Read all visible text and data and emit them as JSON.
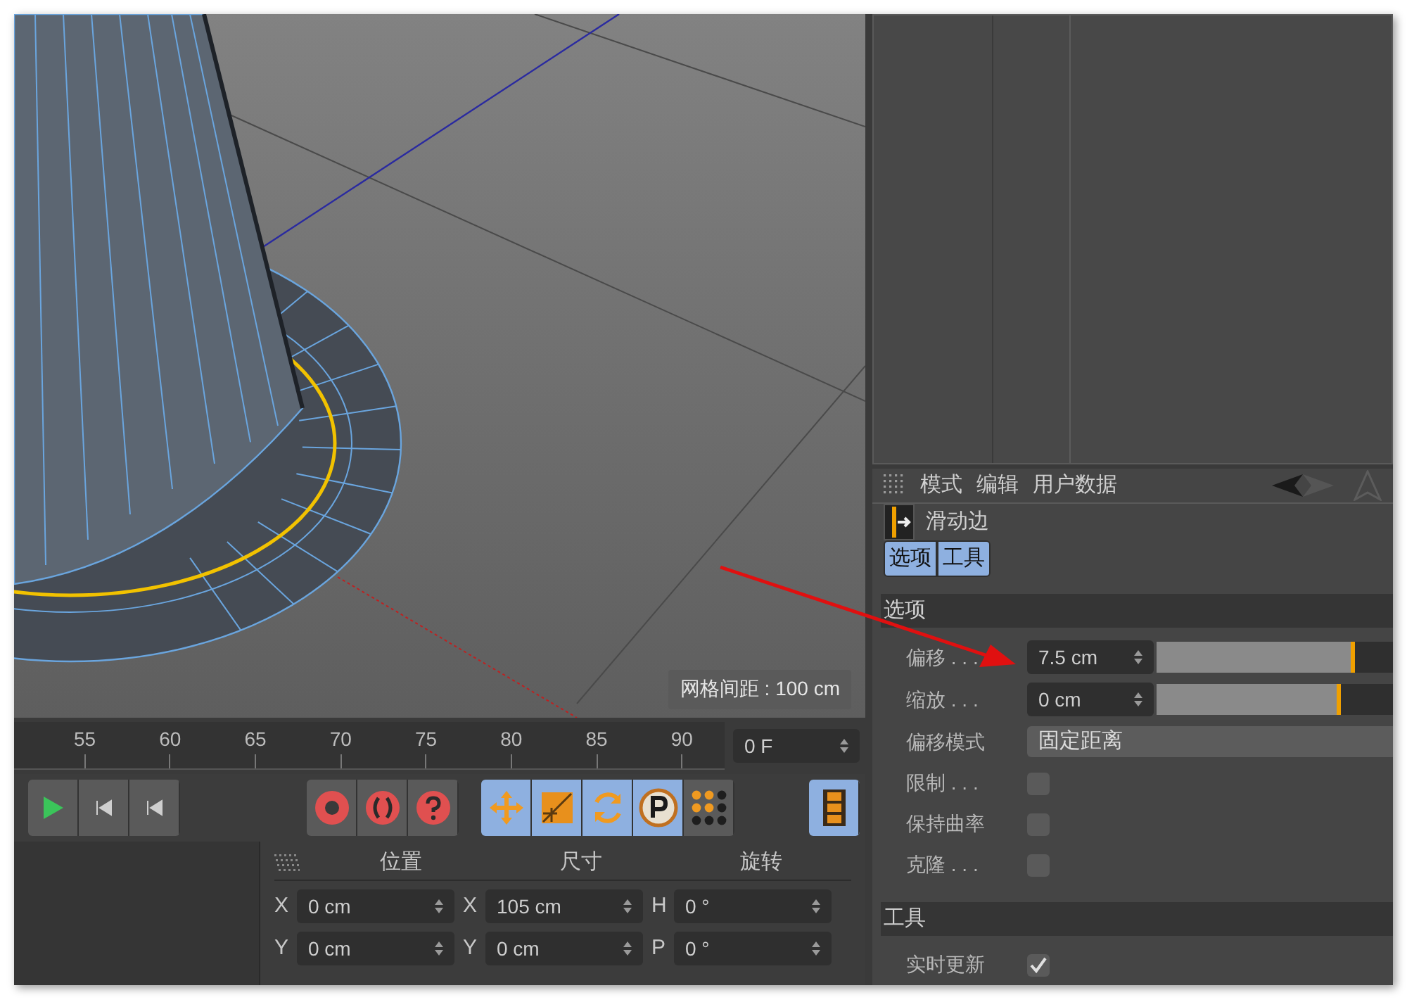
{
  "viewport": {
    "grid_label": "网格间距 : 100 cm"
  },
  "timeline": {
    "ticks": [
      "55",
      "60",
      "65",
      "70",
      "75",
      "80",
      "85",
      "90"
    ],
    "frame_field": "0 F"
  },
  "toolbar": {
    "buttons": [
      {
        "kind": "play"
      },
      {
        "kind": "step"
      },
      {
        "kind": "step"
      },
      {
        "kind": "record"
      },
      {
        "kind": "keys"
      },
      {
        "kind": "help"
      },
      {
        "kind": "move",
        "selected": true
      },
      {
        "kind": "scale",
        "selected": true
      },
      {
        "kind": "rotate",
        "selected": true
      },
      {
        "kind": "param",
        "selected": true
      },
      {
        "kind": "dots",
        "selected": false
      },
      {
        "kind": "film",
        "selected": true
      }
    ]
  },
  "coordinates": {
    "headers": [
      "位置",
      "尺寸",
      "旋转"
    ],
    "rows": [
      [
        {
          "axis": "X",
          "value": "0 cm"
        },
        {
          "axis": "X",
          "value": "105 cm"
        },
        {
          "axis": "H",
          "value": "0 °"
        }
      ],
      [
        {
          "axis": "Y",
          "value": "0 cm"
        },
        {
          "axis": "Y",
          "value": "0 cm"
        },
        {
          "axis": "P",
          "value": "0 °"
        }
      ]
    ]
  },
  "attributes": {
    "menu": [
      "模式",
      "编辑",
      "用户数据"
    ],
    "tool_name": "滑动边",
    "tabs": [
      {
        "label": "选项",
        "selected": true
      },
      {
        "label": "工具",
        "selected": true
      }
    ],
    "sections": [
      {
        "title": "选项",
        "rows": [
          {
            "kind": "slider",
            "label": "偏移 . . .",
            "value": "7.5 cm",
            "level": 0.84
          },
          {
            "kind": "slider",
            "label": "缩放 . . .",
            "value": "0 cm",
            "level": 0.78
          },
          {
            "kind": "dropdown",
            "label": "偏移模式",
            "value": "固定距离"
          },
          {
            "kind": "checkbox",
            "label": "限制 . . .",
            "checked": false
          },
          {
            "kind": "checkbox",
            "label": "保持曲率",
            "checked": false
          },
          {
            "kind": "checkbox",
            "label": "克隆 . . .",
            "checked": false
          }
        ]
      },
      {
        "title": "工具",
        "rows": [
          {
            "kind": "checkbox",
            "label": "实时更新",
            "checked": true
          }
        ]
      }
    ]
  }
}
